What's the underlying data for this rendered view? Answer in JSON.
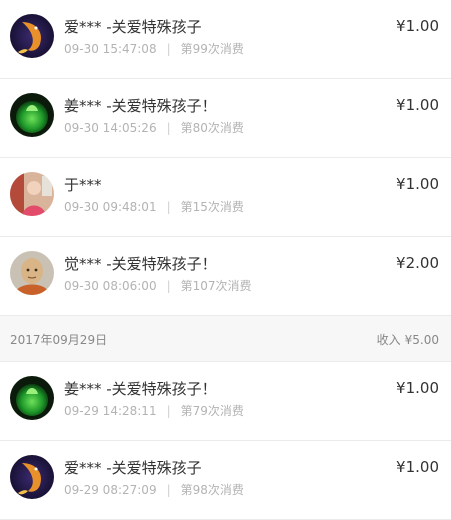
{
  "records_before": [
    {
      "name": "爱*** -关爱特殊孩子",
      "time": "09-30 15:47:08",
      "count": "第99次消费",
      "amount": "¥1.00",
      "avatar": "koi-fish-avatar"
    },
    {
      "name": "姜*** -关爱特殊孩子！",
      "time": "09-30 14:05:26",
      "count": "第80次消费",
      "amount": "¥1.00",
      "avatar": "green-plant-avatar"
    },
    {
      "name": "于***",
      "time": "09-30 09:48:01",
      "count": "第15次消费",
      "amount": "¥1.00",
      "avatar": "person-photo-avatar"
    },
    {
      "name": "觉*** -关爱特殊孩子！",
      "time": "09-30 08:06:00",
      "count": "第107次消费",
      "amount": "¥2.00",
      "avatar": "monk-avatar"
    }
  ],
  "date_group": {
    "date": "2017年09月29日",
    "income_label": "收入",
    "income_amount": "¥5.00"
  },
  "records_after": [
    {
      "name": "姜*** -关爱特殊孩子！",
      "time": "09-29 14:28:11",
      "count": "第79次消费",
      "amount": "¥1.00",
      "avatar": "green-plant-avatar"
    },
    {
      "name": "爱*** -关爱特殊孩子",
      "time": "09-29 08:27:09",
      "count": "第98次消费",
      "amount": "¥1.00",
      "avatar": "koi-fish-avatar"
    }
  ]
}
